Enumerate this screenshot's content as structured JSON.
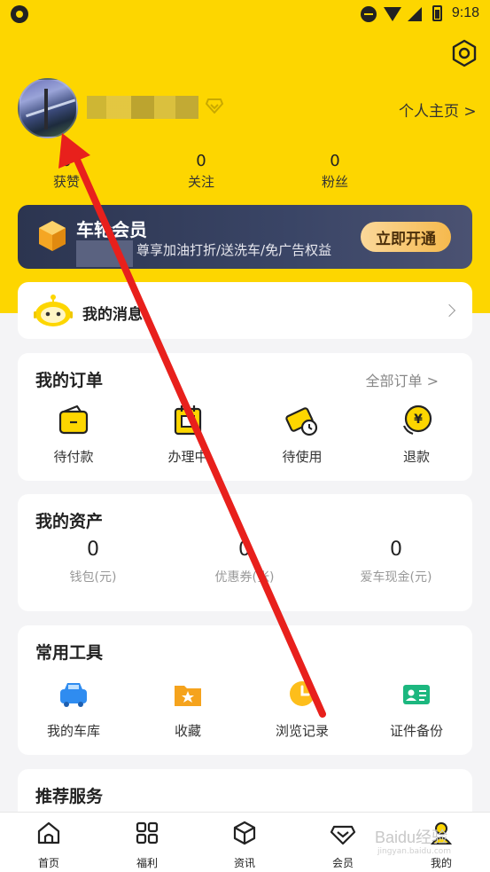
{
  "status_bar": {
    "time": "9:18"
  },
  "profile": {
    "homepage_link": "个人主页 >",
    "stats": [
      {
        "value": "0",
        "label": "获赞"
      },
      {
        "value": "0",
        "label": "关注"
      },
      {
        "value": "0",
        "label": "粉丝"
      }
    ]
  },
  "vip": {
    "title": "车轮会员",
    "subtitle": "尊享加油打折/送洗车/免广告权益",
    "button": "立即开通"
  },
  "messages": {
    "title": "我的消息"
  },
  "orders": {
    "title": "我的订单",
    "all_link": "全部订单 >",
    "items": [
      {
        "label": "待付款",
        "icon": "wallet-icon"
      },
      {
        "label": "办理中",
        "icon": "calendar-icon"
      },
      {
        "label": "待使用",
        "icon": "ticket-icon"
      },
      {
        "label": "退款",
        "icon": "refund-icon"
      }
    ]
  },
  "assets": {
    "title": "我的资产",
    "items": [
      {
        "value": "0",
        "label": "钱包(元)"
      },
      {
        "value": "0",
        "label": "优惠券(张)"
      },
      {
        "value": "0",
        "label": "爱车现金(元)"
      }
    ]
  },
  "tools": {
    "title": "常用工具",
    "items": [
      {
        "label": "我的车库",
        "icon": "car-icon"
      },
      {
        "label": "收藏",
        "icon": "folder-star-icon"
      },
      {
        "label": "浏览记录",
        "icon": "clock-icon"
      },
      {
        "label": "证件备份",
        "icon": "id-card-icon"
      }
    ]
  },
  "recommend": {
    "title": "推荐服务"
  },
  "tabbar": {
    "items": [
      {
        "label": "首页",
        "icon": "home-icon"
      },
      {
        "label": "福利",
        "icon": "grid-icon"
      },
      {
        "label": "资讯",
        "icon": "cube-icon"
      },
      {
        "label": "会员",
        "icon": "diamond-icon"
      },
      {
        "label": "我的",
        "icon": "profile-icon"
      }
    ]
  },
  "watermark": {
    "text": "Baidu经验",
    "sub": "jingyan.baidu.com"
  },
  "colors": {
    "brand_yellow": "#fdd600",
    "annotation_red": "#e8201c"
  }
}
